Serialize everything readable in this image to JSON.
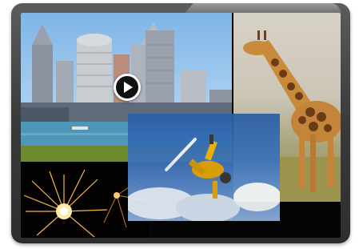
{
  "viewer": {
    "play_control": {
      "icon": "play-icon",
      "label": "Play"
    }
  },
  "tiles": [
    {
      "name": "city-skyline-photo",
      "subject": ""
    },
    {
      "name": "giraffe-photo",
      "subject": ""
    },
    {
      "name": "snowboarder-photo",
      "subject": ""
    },
    {
      "name": "sparkler-photo",
      "subject": ""
    }
  ],
  "colors": {
    "bezel": "#3a3a3a",
    "screen": "#050505",
    "play_button": "#111111"
  }
}
